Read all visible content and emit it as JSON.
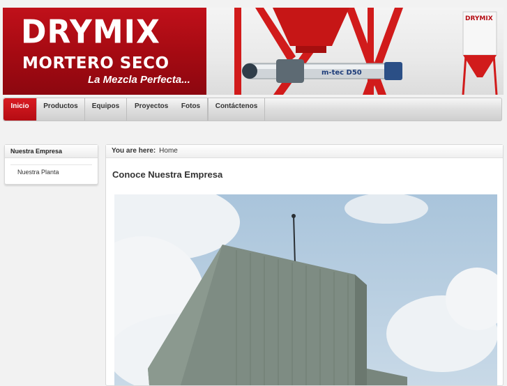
{
  "header": {
    "logo_title": "DRYMIX",
    "logo_subtitle": "MORTERO SECO",
    "logo_tagline": "La Mezcla Perfecta...",
    "machine_label": "m-tec D50",
    "silo_logo": "DRYMIX"
  },
  "nav": {
    "items": [
      {
        "label": "Inicio",
        "active": true
      },
      {
        "label": "Productos"
      },
      {
        "label": "Equipos"
      },
      {
        "label": "Proyectos"
      },
      {
        "label": "Fotos"
      },
      {
        "label": "Contáctenos"
      }
    ],
    "active_color": "#c8121a"
  },
  "sidebar": {
    "title": "Nuestra Empresa",
    "items": [
      {
        "label": "Nuestra Planta"
      }
    ]
  },
  "breadcrumb": {
    "prefix": "You are here:",
    "current": "Home"
  },
  "article": {
    "title": "Conoce Nuestra Empresa",
    "image": "plant-building-photo"
  },
  "colors": {
    "brand_red": "#b50c13",
    "page_bg": "#f2f2f2"
  }
}
